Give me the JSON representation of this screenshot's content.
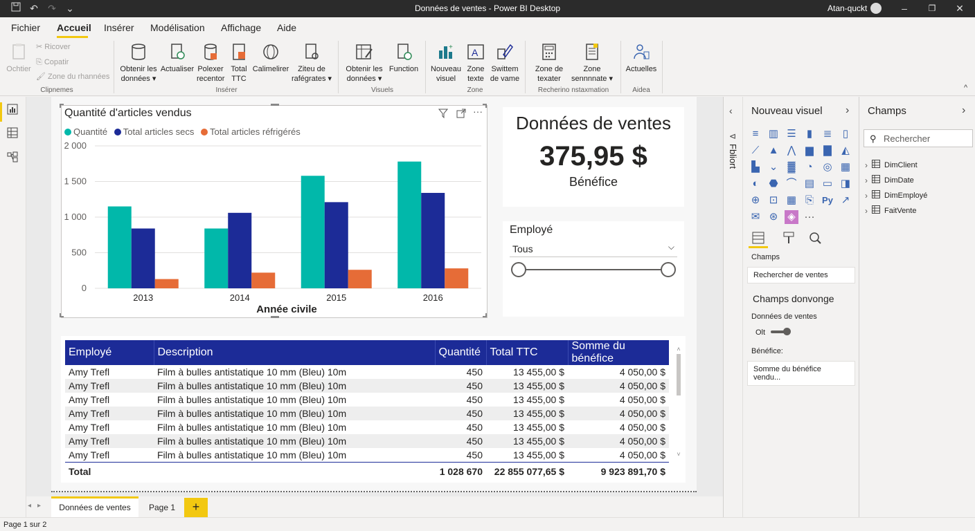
{
  "window": {
    "title": "Données de ventes - Power BI Desktop",
    "user": "Atan-quckt"
  },
  "menu": [
    "Fichier",
    "Accueil",
    "Insérer",
    "Modélisation",
    "Affichage",
    "Aide"
  ],
  "ribbon": {
    "clipboard": {
      "paste": "Ochtier",
      "cut": "Ricover",
      "copy": "Copatir",
      "format": "Zone du rhannées",
      "group": "Clipnemes"
    },
    "insert": {
      "get_data": "Obtenir les données",
      "refresh": "Actualiser",
      "polexer": "Polexer recentor",
      "total": "Total TTC",
      "calimelirer": "Calimelirer",
      "ziteu": "Ziteu de rafégrates",
      "group": "Insérer"
    },
    "visuals": {
      "get_data": "Obtenir les données",
      "function": "Function",
      "group": "Visuels"
    },
    "zone": {
      "new_visual": "Nouveau visuel",
      "text_box": "Zone texte",
      "swittem": "Swittem de vame",
      "group": "Zone"
    },
    "research": {
      "texater": "Zone de texater",
      "sennnnate": "Zone sennnnate",
      "group": "Recherino nstaxmation"
    },
    "help": {
      "actuals": "Actuelles",
      "group": "Aidea"
    }
  },
  "chart_data": {
    "type": "bar",
    "title": "Quantité d'articles vendus",
    "xlabel": "Année civile",
    "ylabel": "",
    "categories": [
      "2013",
      "2014",
      "2015",
      "2016"
    ],
    "series": [
      {
        "name": "Quantité",
        "values": [
          1150,
          840,
          1580,
          1780
        ],
        "color": "#01b8aa"
      },
      {
        "name": "Total articles secs",
        "values": [
          840,
          1060,
          1210,
          1340
        ],
        "color": "#1c2b97"
      },
      {
        "name": "Total articles réfrigérés",
        "values": [
          130,
          220,
          260,
          280
        ],
        "color": "#e66c37"
      }
    ],
    "ylim": [
      0,
      2000
    ],
    "yticks": [
      "0",
      "500",
      "1 000",
      "1 500",
      "2 000"
    ],
    "grid": true,
    "legend": "top-left"
  },
  "kpi": {
    "title": "Données de ventes",
    "value": "375,95 $",
    "label": "Bénéfice"
  },
  "slicer": {
    "title": "Employé",
    "value": "Tous"
  },
  "table": {
    "headers": [
      "Employé",
      "Description",
      "Quantité",
      "Total TTC",
      "Somme du bénéfice"
    ],
    "rows": [
      [
        "Amy Trefl",
        "Film à bulles antistatique 10 mm (Bleu) 10m",
        "450",
        "13 455,00 $",
        "4 050,00 $"
      ],
      [
        "Amy Trefl",
        "Film à bulles antistatique 10 mm (Bleu) 10m",
        "450",
        "13 455,00 $",
        "4 050,00 $"
      ],
      [
        "Amy Trefl",
        "Film à bulles antistatique 10 mm (Bleu) 10m",
        "450",
        "13 455,00 $",
        "4 050,00 $"
      ],
      [
        "Amy Trefl",
        "Film à bulles antistatique 10 mm (Bleu) 10m",
        "450",
        "13 455,00 $",
        "4 050,00 $"
      ],
      [
        "Amy Trefl",
        "Film à bulles antistatique 10 mm (Bleu) 10m",
        "450",
        "13 455,00 $",
        "4 050,00 $"
      ],
      [
        "Amy Trefl",
        "Film à bulles antistatique 10 mm (Bleu) 10m",
        "450",
        "13 455,00 $",
        "4 050,00 $"
      ],
      [
        "Amy Trefl",
        "Film à bulles antistatique 10 mm (Bleu) 10m",
        "450",
        "13 455,00 $",
        "4 050,00 $"
      ]
    ],
    "total": [
      "Total",
      "",
      "1 028 670",
      "22 855 077,65 $",
      "9 923 891,70 $"
    ]
  },
  "filters_label": "Fbliort",
  "visualizations": {
    "title": "Nouveau visuel",
    "fields_label": "Champs",
    "fields_value": "Rechercher de ventes",
    "drill_title": "Champs donvonge",
    "drill_field": "Données de ventes",
    "toggle_label": "Olt",
    "benefit_label": "Bénéfice:",
    "benefit_value": "Somme du bénéfice vendu...",
    "py": "Py",
    "more": "···"
  },
  "fields": {
    "title": "Champs",
    "search_placeholder": "Rechercher",
    "tables": [
      "DimClient",
      "DimDate",
      "DimEmployé",
      "FaitVente"
    ]
  },
  "tabs": {
    "active": "Données de ventes",
    "other": "Page 1",
    "add": "+"
  },
  "status": "Page 1 sur 2",
  "colors": {
    "accent": "#f2c811",
    "table_header": "#1c2b97"
  }
}
